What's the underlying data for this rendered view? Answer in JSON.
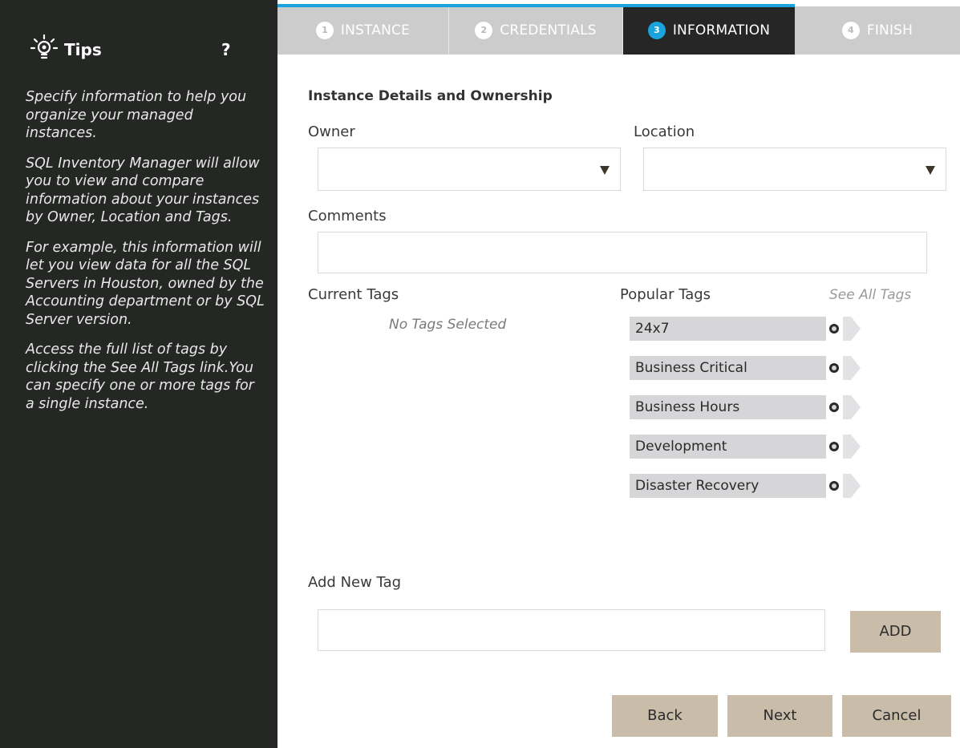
{
  "colors": {
    "sidebar_bg": "#252725",
    "step_inactive": "#cccccc",
    "step_active": "#262626",
    "accent_blue": "#1aa3dd",
    "button_bg": "#c9bda9",
    "tag_bg": "#d6d5d7"
  },
  "sidebar": {
    "title": "Tips",
    "help": "?",
    "icon": "lightbulb-icon",
    "paragraphs": [
      "Specify information to help you organize your managed instances.",
      "SQL Inventory Manager will allow you to view and compare information about your instances by Owner, Location and Tags.",
      "For example, this information will let you view data for all the SQL Servers in Houston, owned by the Accounting department or by SQL Server version.",
      "Access the full list of tags by clicking the See All Tags link.You can specify one or more tags for a single instance."
    ]
  },
  "stepper": {
    "steps": [
      {
        "num": "1",
        "label": "INSTANCE",
        "active": false
      },
      {
        "num": "2",
        "label": "CREDENTIALS",
        "active": false
      },
      {
        "num": "3",
        "label": "INFORMATION",
        "active": true
      },
      {
        "num": "4",
        "label": "FINISH",
        "active": false
      }
    ]
  },
  "form": {
    "section_title": "Instance Details and Ownership",
    "owner_label": "Owner",
    "owner_value": "",
    "location_label": "Location",
    "location_value": "",
    "comments_label": "Comments",
    "comments_value": "",
    "current_tags_label": "Current Tags",
    "no_tags_text": "No Tags Selected",
    "popular_tags_label": "Popular Tags",
    "see_all_tags": "See All Tags",
    "popular_tags": [
      "24x7",
      "Business Critical",
      "Business Hours",
      "Development",
      "Disaster Recovery"
    ],
    "add_new_tag_label": "Add New Tag",
    "add_new_tag_value": "",
    "add_button": "ADD"
  },
  "footer": {
    "back": "Back",
    "next": "Next",
    "cancel": "Cancel"
  }
}
